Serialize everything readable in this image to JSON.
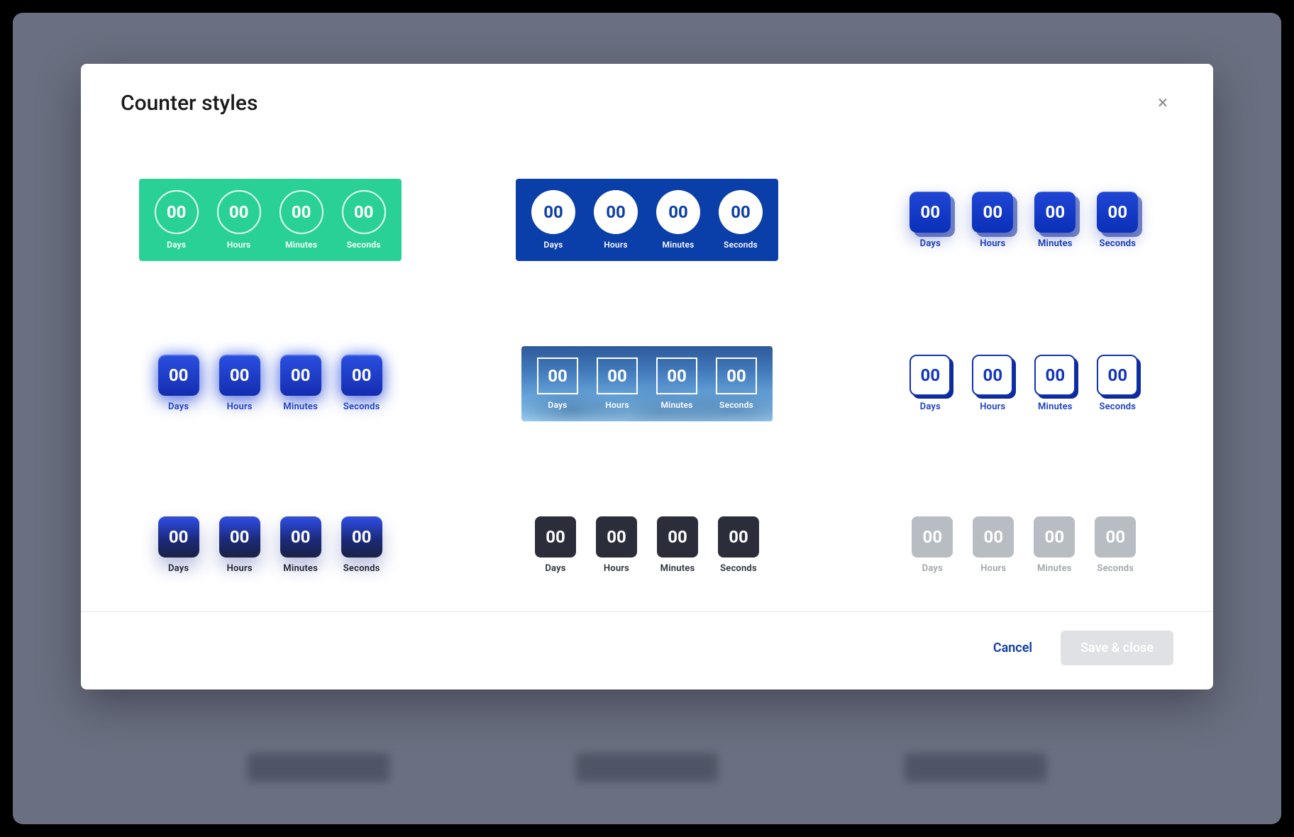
{
  "modal": {
    "title": "Counter styles",
    "close_glyph": "×",
    "units": [
      "Days",
      "Hours",
      "Minutes",
      "Seconds"
    ],
    "value_display": "00"
  },
  "footer": {
    "cancel_label": "Cancel",
    "save_label": "Save & close"
  },
  "styles": [
    {
      "id": "s1",
      "name": "green-circle-outline"
    },
    {
      "id": "s2",
      "name": "blue-panel-white-circle"
    },
    {
      "id": "s3",
      "name": "blue-3d-button"
    },
    {
      "id": "s4",
      "name": "blue-glow-button"
    },
    {
      "id": "s5",
      "name": "mountain-outline-square"
    },
    {
      "id": "s6",
      "name": "white-blue-outline"
    },
    {
      "id": "s7",
      "name": "blue-dark-gradient"
    },
    {
      "id": "s8",
      "name": "charcoal-flat"
    },
    {
      "id": "s9",
      "name": "grey-muted"
    }
  ]
}
